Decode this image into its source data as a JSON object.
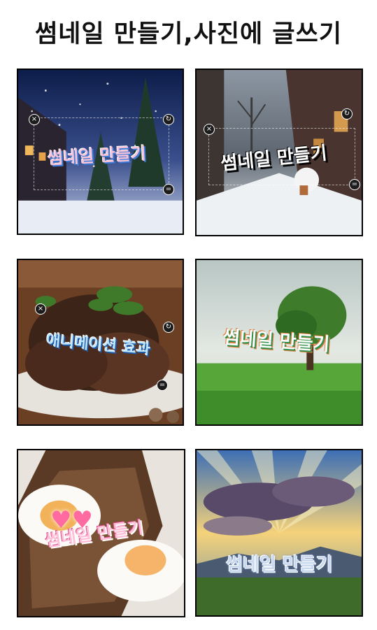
{
  "page": {
    "title": "썸네일 만들기,사진에 글쓰기"
  },
  "tiles": [
    {
      "caption": "썸네일 만들기",
      "theme": "snowy-street-night"
    },
    {
      "caption": "썸네일 만들기",
      "theme": "snowy-street-day"
    },
    {
      "caption": "애니메이션 효과",
      "theme": "grilled-meat"
    },
    {
      "caption": "썸네일 만들기",
      "theme": "tree-on-grass"
    },
    {
      "caption": "썸네일 만들기",
      "theme": "fried-eggs-toast"
    },
    {
      "caption": "썸네일 만들기",
      "theme": "sunrays-clouds"
    }
  ],
  "controls": {
    "close_icon": "×",
    "rotate_icon": "↻",
    "resize_icon": "="
  },
  "colors": {
    "frame_border": "#000000",
    "text_white": "#ffffff"
  }
}
